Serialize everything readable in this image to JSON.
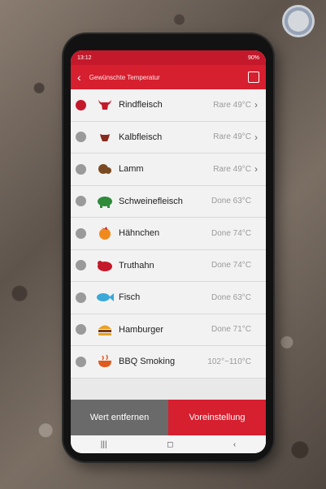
{
  "app": {
    "title": "Gewünschte Temperatur",
    "subtitle": "",
    "status_time": "13:12",
    "status_right": "90%"
  },
  "list": [
    {
      "name": "Rindfleisch",
      "temp": "Rare 49°C",
      "selected": true,
      "chevron": true,
      "icon": "bull-icon",
      "icon_color": "#c4192b"
    },
    {
      "name": "Kalbfleisch",
      "temp": "Rare 49°C",
      "selected": false,
      "chevron": true,
      "icon": "calf-icon",
      "icon_color": "#8a2a1e"
    },
    {
      "name": "Lamm",
      "temp": "Rare 49°C",
      "selected": false,
      "chevron": true,
      "icon": "lamb-icon",
      "icon_color": "#7a4a22"
    },
    {
      "name": "Schweinefleisch",
      "temp": "Done 63°C",
      "selected": false,
      "chevron": false,
      "icon": "pig-icon",
      "icon_color": "#2e8b3a"
    },
    {
      "name": "Hähnchen",
      "temp": "Done 74°C",
      "selected": false,
      "chevron": false,
      "icon": "chicken-icon",
      "icon_color": "#f08a1e"
    },
    {
      "name": "Truthahn",
      "temp": "Done 74°C",
      "selected": false,
      "chevron": false,
      "icon": "turkey-icon",
      "icon_color": "#c4192b"
    },
    {
      "name": "Fisch",
      "temp": "Done 63°C",
      "selected": false,
      "chevron": false,
      "icon": "fish-icon",
      "icon_color": "#3aa8d8"
    },
    {
      "name": "Hamburger",
      "temp": "Done 71°C",
      "selected": false,
      "chevron": false,
      "icon": "burger-icon",
      "icon_color": "#e8a020"
    },
    {
      "name": "BBQ Smoking",
      "temp": "102°~110°C",
      "selected": false,
      "chevron": false,
      "icon": "bbq-icon",
      "icon_color": "#e05a1e"
    }
  ],
  "buttons": {
    "remove": "Wert entfernen",
    "preset": "Voreinstellung"
  },
  "navbar": {
    "recent": "|||",
    "home": "◻",
    "back": "‹"
  },
  "colors": {
    "accent": "#d61f2f",
    "status_bar": "#c4192b",
    "remove_button": "#6a6a6a"
  }
}
